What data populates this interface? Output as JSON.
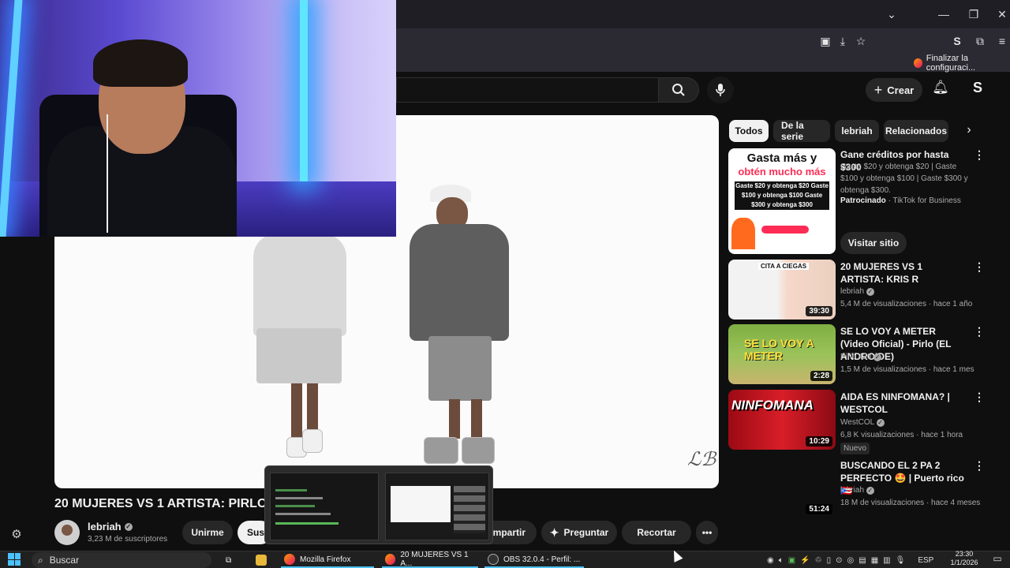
{
  "browser": {
    "bookmark_item": "Finalizar la configuraci..."
  },
  "youtube": {
    "create_label": "Crear",
    "chips": [
      "Todos",
      "De la serie",
      "lebriah",
      "Relacionados"
    ]
  },
  "video": {
    "title": "20 MUJERES VS 1 ARTISTA: PIRLO 4",
    "channel": "lebriah",
    "subscribers": "3,23 M de suscriptores",
    "join_label": "Unirme",
    "subscribe_label": "Susc",
    "share_label": "ompartir",
    "ask_label": "Preguntar",
    "clip_label": "Recortar"
  },
  "ad": {
    "thumb_line1": "Gasta más y",
    "thumb_line2": "obtén mucho más",
    "thumb_offer": "Gaste $20 y obtenga $20 Gaste $100 y obtenga $100 Gaste $300 y obtenga $300",
    "title": "Gane créditos por hasta $300",
    "description": "Gaste $20 y obtenga $20 | Gaste $100 y obtenga $100 | Gaste $300 y obtenga $300.",
    "sponsor_label": "Patrocinado",
    "sponsor_name": "TikTok for Business",
    "cta_label": "Visitar sitio"
  },
  "recommendations": [
    {
      "title": "20 MUJERES VS 1 ARTISTA: KRIS R",
      "channel": "lebriah",
      "meta": "5,4 M de visualizaciones · hace 1 año",
      "duration": "39:30",
      "thumb_text": "CITA A CIEGAS"
    },
    {
      "title": "SE LO VOY A METER (Video Oficial) - Pirlo (EL ANDROIDE)",
      "channel": "Pirlo 420",
      "meta": "1,5 M de visualizaciones · hace 1 mes",
      "duration": "2:28",
      "thumb_text": "SE LO VOY A METER"
    },
    {
      "title": "AIDA ES NINFOMANA? | WESTCOL",
      "channel": "WestCOL",
      "meta": "6,8 K visualizaciones · hace 1 hora",
      "duration": "10:29",
      "thumb_text": "NINFOMANA",
      "badge": "Nuevo"
    },
    {
      "title": "BUSCANDO EL 2 PA 2 PERFECTO 🤩 | Puerto rico 🇵🇷",
      "channel": "lebriah",
      "meta": "18 M de visualizaciones · hace 4 meses",
      "duration": "51:24"
    }
  ],
  "taskbar": {
    "search": "Buscar",
    "apps": [
      "Mozilla Firefox",
      "20 MUJERES VS 1 A...",
      "OBS 32.0.4 - Perfil: ..."
    ],
    "lang": "ESP",
    "time": "23:30",
    "date": "1/1/2026"
  },
  "colors": {
    "youtube_bg": "#0f0f0f",
    "chip_active": "#f1f1f1",
    "tiktok_pink": "#fe2c55",
    "windows_accent": "#4cc2ff"
  }
}
